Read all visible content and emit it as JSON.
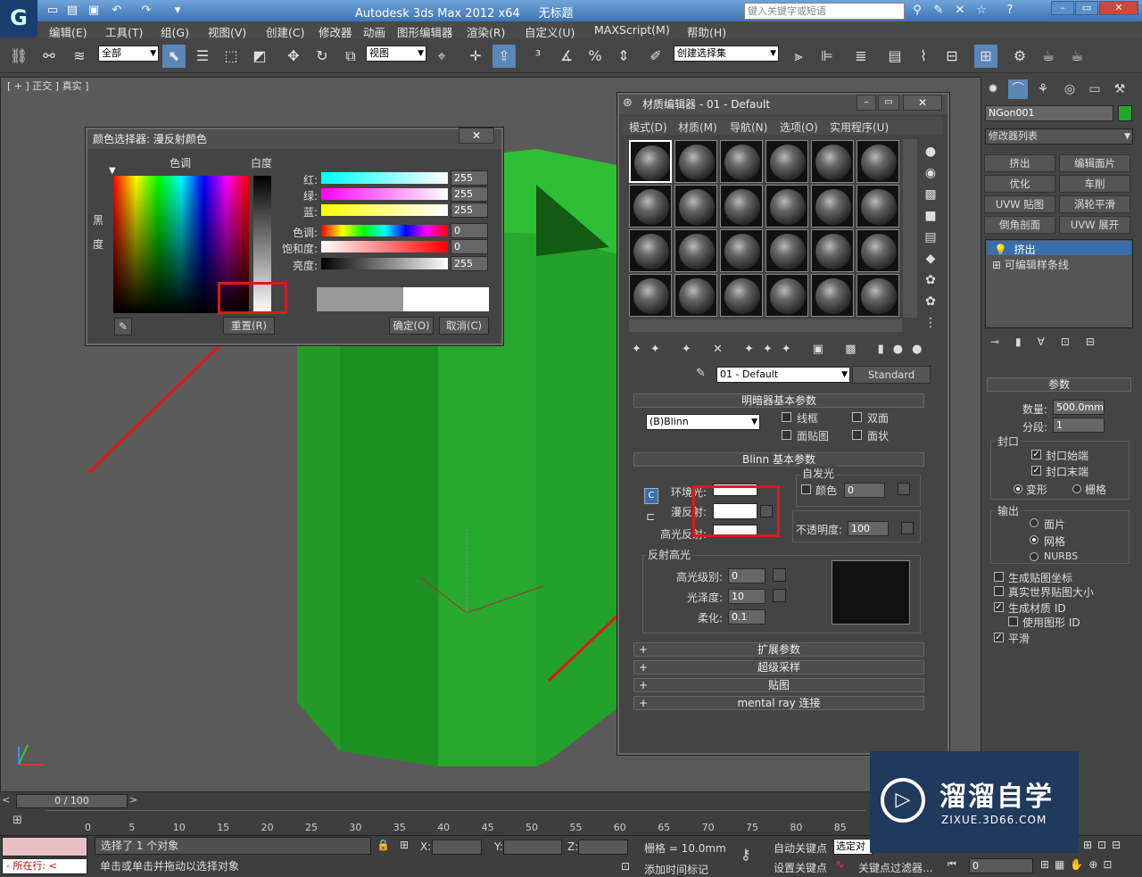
{
  "app": {
    "title": "Autodesk 3ds Max  2012 x64",
    "doc": "无标题",
    "search_placeholder": "键入关键字或短语"
  },
  "menu": [
    "编辑(E)",
    "工具(T)",
    "组(G)",
    "视图(V)",
    "创建(C)",
    "修改器",
    "动画",
    "图形编辑器",
    "渲染(R)",
    "自定义(U)",
    "MAXScript(M)",
    "帮助(H)"
  ],
  "toolbar": {
    "filter": "全部",
    "view": "视图",
    "selset": "创建选择集"
  },
  "viewport": {
    "label": "[ + ] 正交 ] 真实 ]"
  },
  "colorpicker": {
    "title": "颜色选择器: 漫反射颜色",
    "hue_label": "色调",
    "white_label": "白度",
    "black_label_1": "黑",
    "black_label_2": "度",
    "rows": [
      {
        "label": "红:",
        "value": "255"
      },
      {
        "label": "绿:",
        "value": "255"
      },
      {
        "label": "蓝:",
        "value": "255"
      },
      {
        "label": "色调:",
        "value": "0"
      },
      {
        "label": "饱和度:",
        "value": "0"
      },
      {
        "label": "亮度:",
        "value": "255"
      }
    ],
    "reset": "重置(R)",
    "ok": "确定(O)",
    "cancel": "取消(C)"
  },
  "mateditor": {
    "title": "材质编辑器 - 01 - Default",
    "menu": [
      "模式(D)",
      "材质(M)",
      "导航(N)",
      "选项(O)",
      "实用程序(U)"
    ],
    "matname": "01 - Default",
    "mattype": "Standard",
    "shader_title": "明暗器基本参数",
    "shader": "(B)Blinn",
    "wire": "线框",
    "twosided": "双面",
    "facemap": "面贴图",
    "faceted": "面状",
    "blinn_title": "Blinn 基本参数",
    "selfillum": "自发光",
    "color": "颜色",
    "color_val": "0",
    "ambient": "环境光:",
    "diffuse": "漫反射:",
    "specular": "高光反射:",
    "opacity": "不透明度:",
    "opacity_val": "100",
    "spec_hl": "反射高光",
    "spec_level": "高光级别:",
    "spec_level_val": "0",
    "gloss": "光泽度:",
    "gloss_val": "10",
    "soften": "柔化:",
    "soften_val": "0.1",
    "rollouts": [
      "扩展参数",
      "超级采样",
      "贴图",
      "mental ray 连接"
    ]
  },
  "rpanel": {
    "objname": "NGon001",
    "modlist": "修改器列表",
    "buttons": [
      "挤出",
      "编辑面片",
      "优化",
      "车削",
      "UVW 贴图",
      "涡轮平滑",
      "倒角剖面",
      "UVW 展开"
    ],
    "stack": [
      "挤出",
      "可编辑样条线"
    ],
    "params_title": "参数",
    "amount_label": "数量:",
    "amount": "500.0mm",
    "segs_label": "分段:",
    "segs": "1",
    "cap": "封口",
    "cap_start": "封口始端",
    "cap_end": "封口末端",
    "morph": "变形",
    "grid": "栅格",
    "output": "输出",
    "patch": "面片",
    "mesh": "网格",
    "nurbs": "NURBS",
    "gen_map": "生成贴图坐标",
    "real_world": "真实世界贴图大小",
    "gen_matid": "生成材质 ID",
    "use_shape_id": "使用图形 ID",
    "smooth": "平滑"
  },
  "timeline": {
    "frames": "0 / 100",
    "ticks": [
      "0",
      "5",
      "10",
      "15",
      "20",
      "25",
      "30",
      "35",
      "40",
      "45",
      "50",
      "55",
      "60",
      "65",
      "70",
      "75",
      "80",
      "85",
      "90"
    ]
  },
  "status": {
    "selected": "选择了 1 个对象",
    "hint": "单击或单击并拖动以选择对象",
    "now": "所在行:",
    "x": "X:",
    "y": "Y:",
    "z": "Z:",
    "grid": "栅格 = 10.0mm",
    "autokey": "自动关键点",
    "autokey_sel": "选定对",
    "setkey": "设置关键点",
    "keyfilter": "关键点过滤器...",
    "addtime": "添加时间标记",
    "frame": "0"
  },
  "watermark": {
    "brand": "溜溜自学",
    "url": "ZIXUE.3D66.COM"
  },
  "colors": {
    "accent_red": "#e01818",
    "cylinder": "#22a82a"
  }
}
